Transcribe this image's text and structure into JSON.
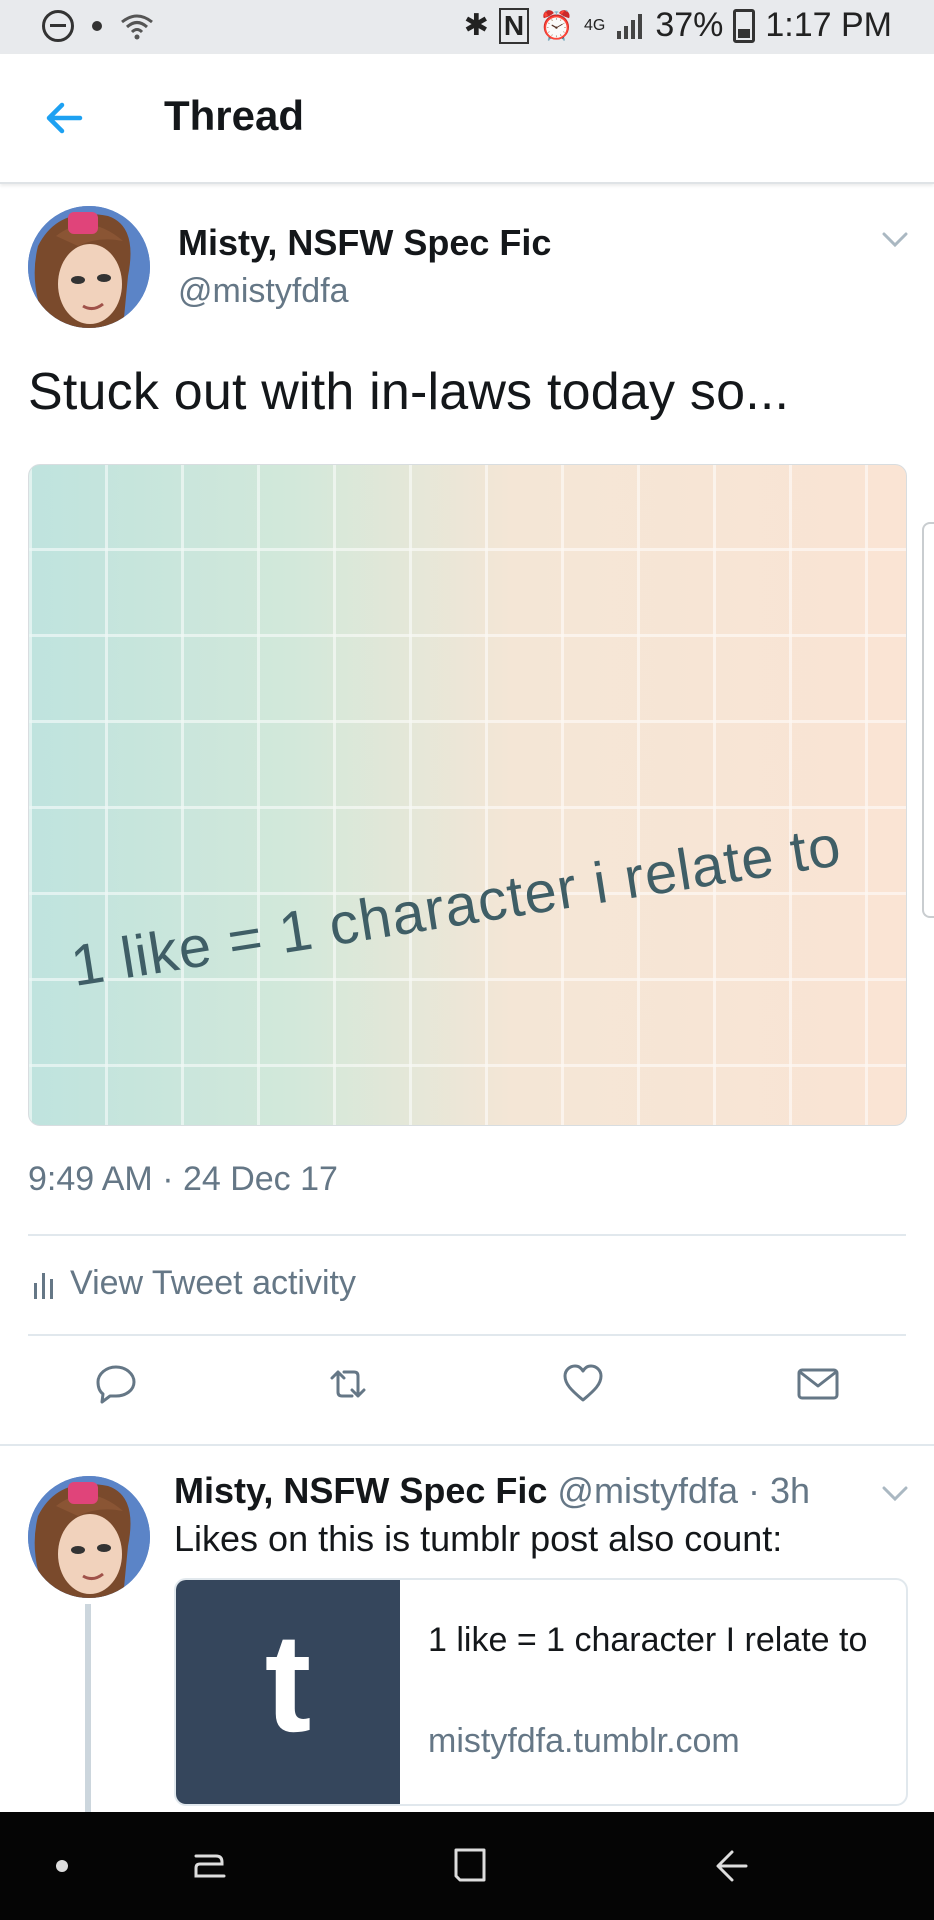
{
  "status_bar": {
    "battery": "37%",
    "time": "1:17 PM",
    "network": "4G"
  },
  "header": {
    "title": "Thread"
  },
  "tweet": {
    "author_name": "Misty, NSFW Spec Fic",
    "author_handle": "@mistyfdfa",
    "text": "Stuck out with in-laws today so...",
    "image_text": "1 like = 1 character i relate to",
    "timestamp": "9:49 AM · 24 Dec 17",
    "activity_label": "View Tweet activity"
  },
  "reply": {
    "author_name": "Misty, NSFW Spec Fic",
    "author_handle": "@mistyfdfa",
    "time_ago": "· 3h",
    "text": "Likes on this is tumblr post also count:",
    "card": {
      "thumb_letter": "t",
      "title": "1 like = 1 character I relate to",
      "domain": "mistyfdfa.tumblr.com"
    }
  },
  "colors": {
    "accent": "#1da1f2",
    "secondary_text": "#657786",
    "tumblr": "#35465c"
  },
  "icons": [
    "back-arrow-icon",
    "chevron-down-icon",
    "reply-icon",
    "retweet-icon",
    "like-icon",
    "dm-icon",
    "activity-icon",
    "tumblr-icon"
  ]
}
